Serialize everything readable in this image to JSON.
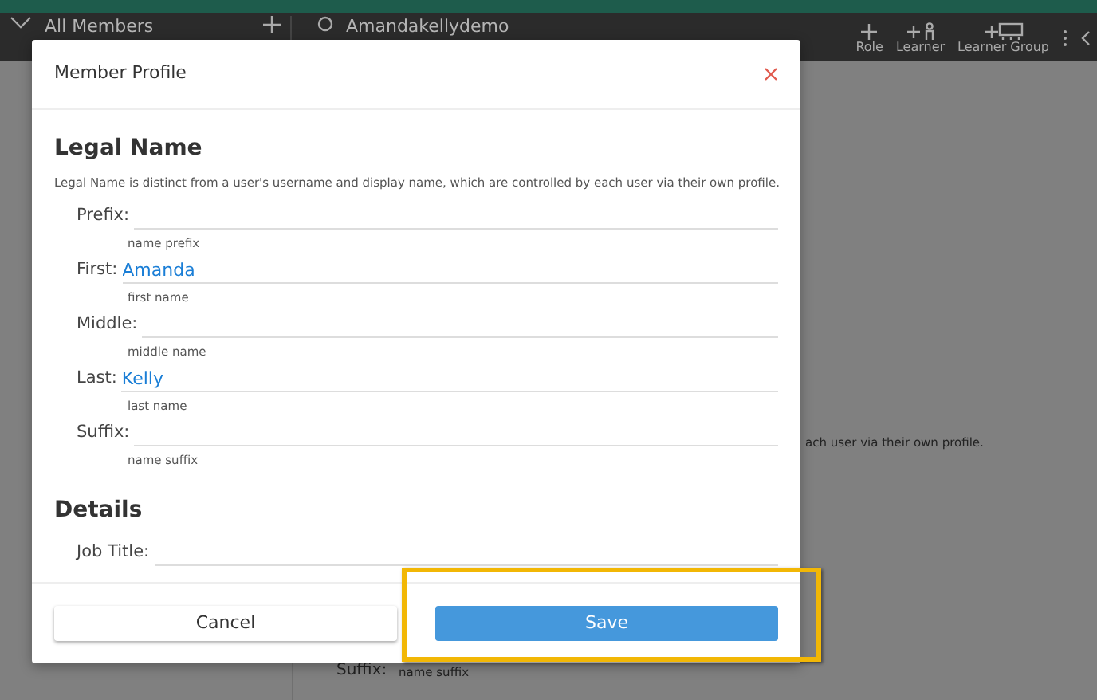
{
  "header": {
    "group_title": "All Members",
    "user_name": "Amandakellydemo",
    "actions": [
      {
        "label": "Role",
        "kind": "plain"
      },
      {
        "label": "Learner",
        "kind": "person"
      },
      {
        "label": "Learner Group",
        "kind": "group"
      }
    ]
  },
  "background": {
    "description_tail": "ach user via their own profile.",
    "suffix_label": "Suffix:",
    "suffix_hint": "name suffix"
  },
  "modal": {
    "title": "Member Profile",
    "sections": [
      {
        "heading": "Legal Name",
        "description": "Legal Name is distinct from a user's username and display name, which are controlled by each user via their own profile.",
        "fields": [
          {
            "label": "Prefix:",
            "hint": "name prefix"
          },
          {
            "label": "First:",
            "value": "Amanda",
            "hint": "first name"
          },
          {
            "label": "Middle:",
            "hint": "middle name"
          },
          {
            "label": "Last:",
            "value": "Kelly",
            "hint": "last name"
          },
          {
            "label": "Suffix:",
            "hint": "name suffix"
          }
        ]
      },
      {
        "heading": "Details",
        "fields": [
          {
            "label": "Job Title:"
          }
        ]
      }
    ],
    "buttons": [
      {
        "label": "Cancel",
        "kind": "secondary",
        "highlighted": false
      },
      {
        "label": "Save",
        "kind": "primary",
        "highlighted": true
      }
    ]
  }
}
